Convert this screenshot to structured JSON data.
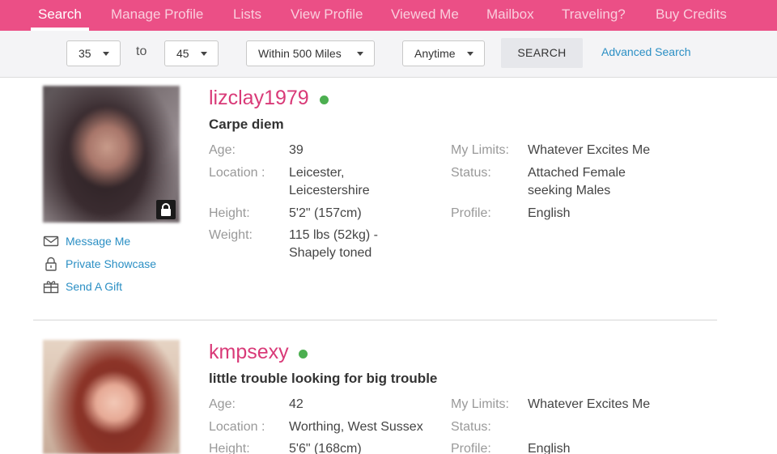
{
  "nav": {
    "items": [
      "Search",
      "Manage Profile",
      "Lists",
      "View Profile",
      "Viewed Me",
      "Mailbox",
      "Traveling?",
      "Buy Credits"
    ],
    "active_index": 0
  },
  "filters": {
    "age_from": "35",
    "to_label": "to",
    "age_to": "45",
    "distance": "Within 500 Miles",
    "time": "Anytime",
    "search_button": "SEARCH",
    "advanced_link": "Advanced Search"
  },
  "profiles": [
    {
      "username": "lizclay1979",
      "online": true,
      "tagline": "Carpe diem",
      "photo_locked": true,
      "actions": [
        "Message Me",
        "Private Showcase",
        "Send A Gift"
      ],
      "fields": {
        "age_label": "Age:",
        "age": "39",
        "location_label": "Location :",
        "location": "Leicester, Leicestershire",
        "height_label": "Height:",
        "height": "5'2\" (157cm)",
        "weight_label": "Weight:",
        "weight": "115 lbs (52kg) - Shapely toned",
        "limits_label": "My Limits:",
        "limits": "Whatever Excites Me",
        "status_label": "Status:",
        "status": "Attached Female seeking Males",
        "profile_label": "Profile:",
        "profile": "English"
      }
    },
    {
      "username": "kmpsexy",
      "online": true,
      "tagline": "little trouble looking for big trouble",
      "fields": {
        "age_label": "Age:",
        "age": "42",
        "location_label": "Location :",
        "location": "Worthing, West Sussex",
        "height_label": "Height:",
        "height": "5'6\" (168cm)",
        "limits_label": "My Limits:",
        "limits": "Whatever Excites Me",
        "status_label": "Status:",
        "status": "",
        "profile_label": "Profile:",
        "profile": "English"
      }
    }
  ],
  "colors": {
    "brand_pink": "#eb4f86",
    "username_pink": "#d93a78",
    "link_blue": "#2b8fc4",
    "online_green": "#4caf50"
  },
  "icons": [
    "envelope-icon",
    "padlock-icon",
    "gift-icon",
    "lock-icon",
    "caret-down-icon",
    "online-status-dot"
  ]
}
